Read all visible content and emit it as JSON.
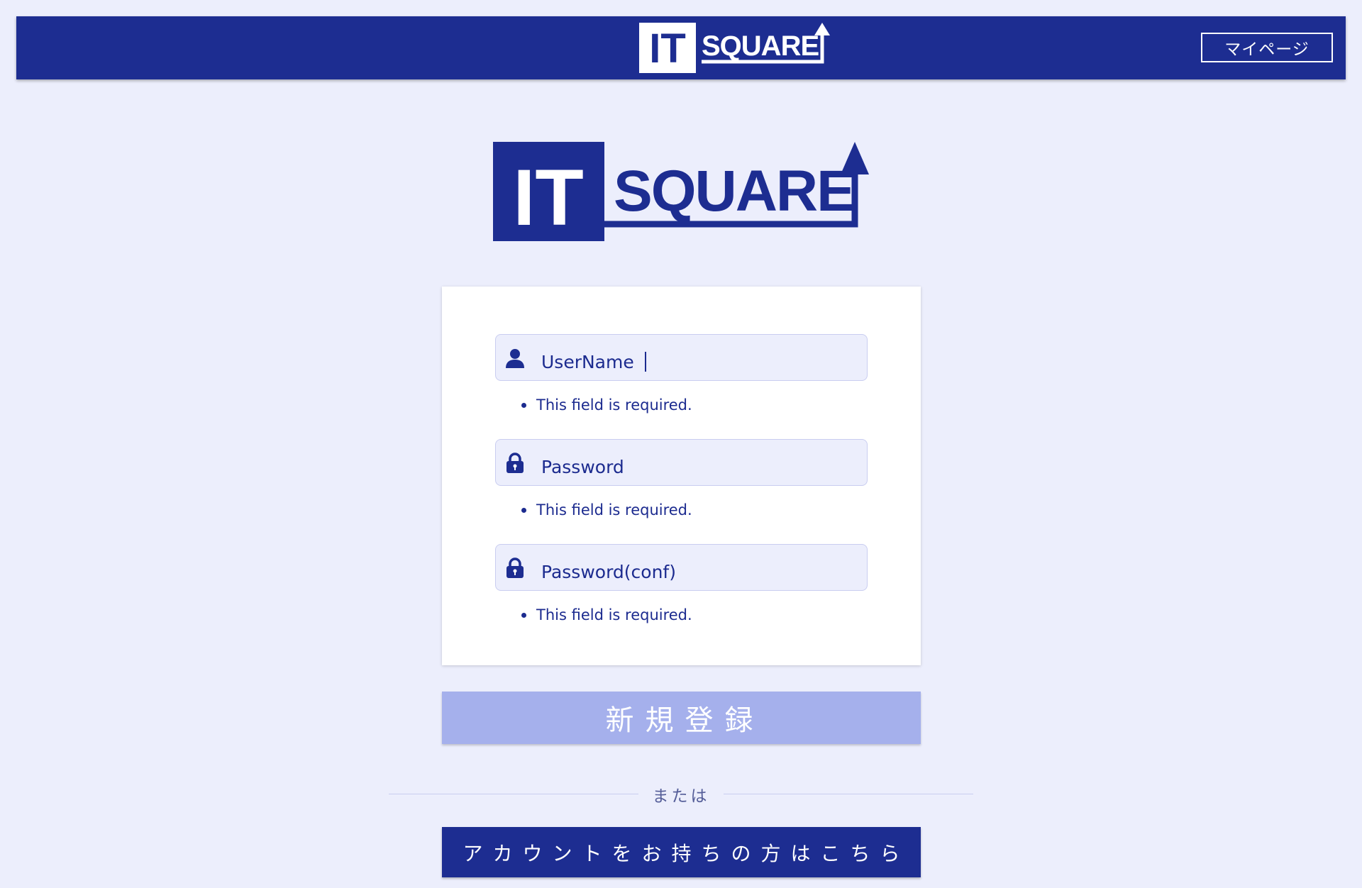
{
  "header": {
    "logo_text_it": "IT",
    "logo_text_square": "SQUARE",
    "mypage_label": "マイページ"
  },
  "logo": {
    "text_it": "IT",
    "text_square": "SQUARE"
  },
  "form": {
    "username": {
      "placeholder": "UserName",
      "icon": "user-icon",
      "error": "This field is required."
    },
    "password": {
      "placeholder": "Password",
      "icon": "lock-icon",
      "error": "This field is required."
    },
    "password_conf": {
      "placeholder": "Password(conf)",
      "icon": "lock-icon",
      "error": "This field is required."
    }
  },
  "register_label": "新規登録",
  "or_label": "または",
  "login_label": "アカウントをお持ちの方はこちら",
  "colors": {
    "primary": "#1d2d91",
    "background": "#eceefc",
    "register_button": "#a5b0ec",
    "card": "#ffffff"
  }
}
